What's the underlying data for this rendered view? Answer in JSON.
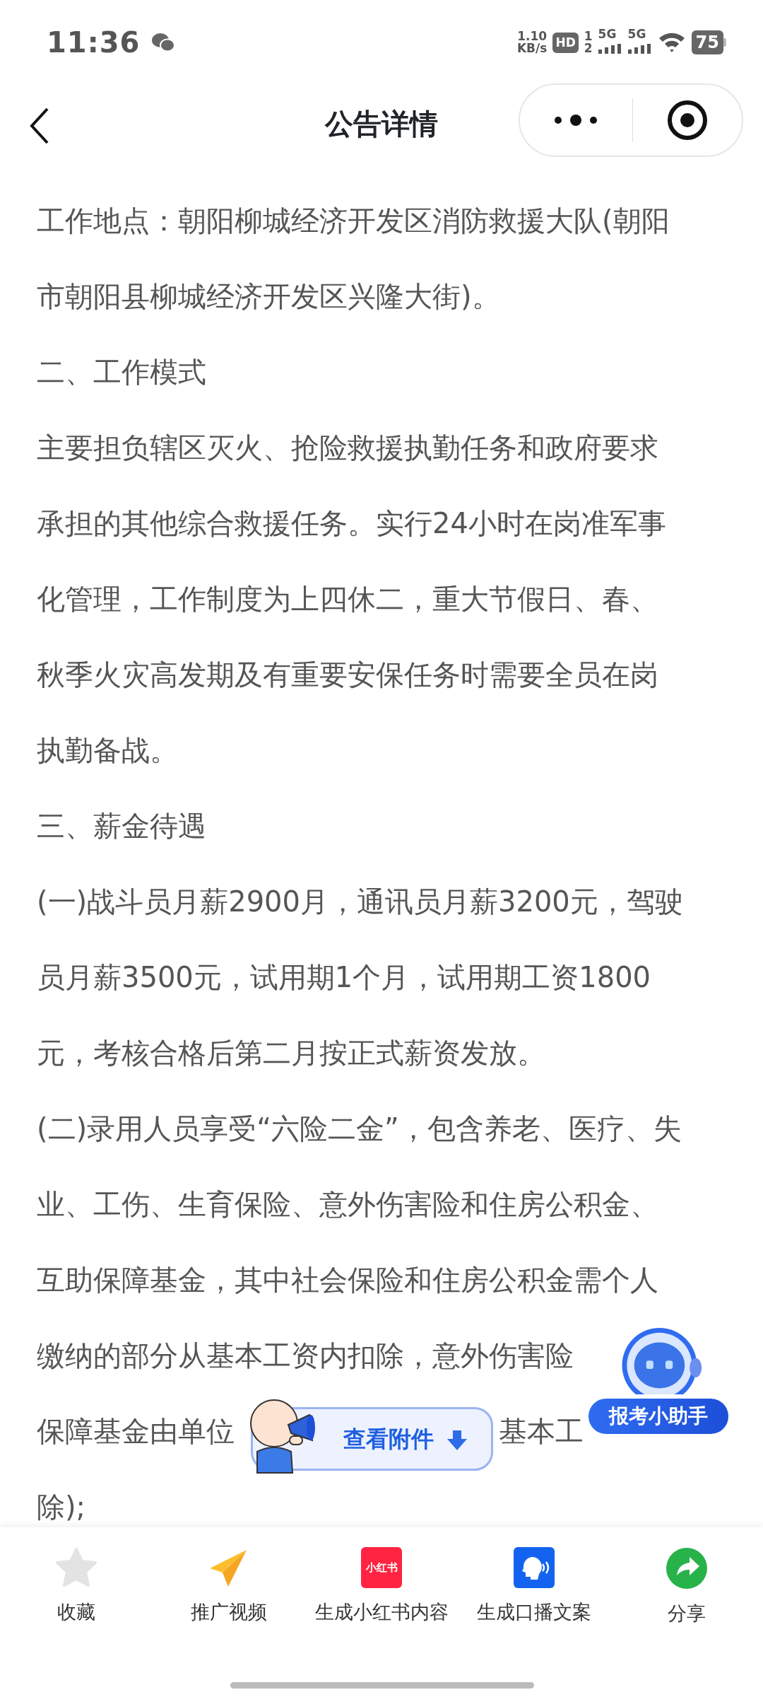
{
  "status_bar": {
    "time": "11:36",
    "net_speed": "1.10",
    "net_unit": "KB/s",
    "sim_badge": "HD",
    "sim_slots": [
      "1",
      "2"
    ],
    "networks": [
      "5G",
      "5G"
    ],
    "battery": "75"
  },
  "nav": {
    "title": "公告详情"
  },
  "paragraphs": [
    {
      "lines": [
        "工作地点：朝阳柳城经济开发区消防救援大队(朝阳",
        "市朝阳县柳城经济开发区兴隆大街)。"
      ]
    },
    {
      "lines": [
        "二、工作模式"
      ]
    },
    {
      "lines": [
        "主要担负辖区灭火、抢险救援执勤任务和政府要求",
        "承担的其他综合救援任务。实行24小时在岗准军事",
        "化管理，工作制度为上四休二，重大节假日、春、",
        "秋季火灾高发期及有重要安保任务时需要全员在岗",
        "执勤备战。"
      ]
    },
    {
      "lines": [
        "三、薪金待遇"
      ]
    },
    {
      "lines": [
        "(一)战斗员月薪2900月，通讯员月薪3200元，驾驶",
        "员月薪3500元，试用期1个月，试用期工资1800",
        "元，考核合格后第二月按正式薪资发放。"
      ]
    },
    {
      "lines": [
        "(二)录用人员享受“六险二金”，包含养老、医疗、失",
        "业、工伤、生育保险、意外伤害险和住房公积金、",
        "互助保障基金，其中社会保险和住房公积金需个人"
      ]
    }
  ],
  "partial_line": "缴纳的部分从基本工资内扣除，意外伤害险",
  "covered_line": [
    "保障基金由单位",
    "基本工"
  ],
  "last_line": "除);",
  "attachment_button": {
    "label": "查看附件"
  },
  "assistant": {
    "label": "报考小助手"
  },
  "bottom_actions": [
    {
      "kind": "star",
      "label": "收藏"
    },
    {
      "kind": "plane",
      "label": "推广视频"
    },
    {
      "kind": "xhs",
      "label": "生成小红书内容",
      "icon_text": "小红书"
    },
    {
      "kind": "voice",
      "label": "生成口播文案"
    },
    {
      "kind": "share",
      "label": "分享"
    }
  ]
}
